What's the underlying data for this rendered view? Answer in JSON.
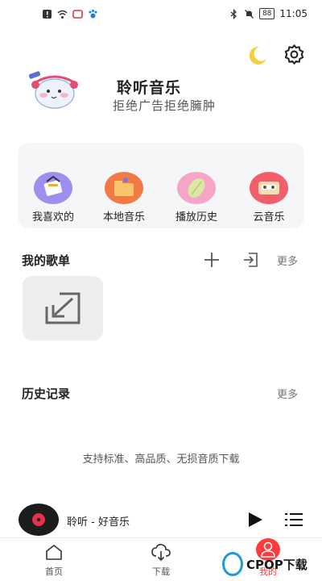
{
  "status_bar": {
    "time": "11:05",
    "battery": "88",
    "left_icons": [
      "notification-icon",
      "wifi-icon",
      "app-icon",
      "paw-icon"
    ],
    "right_icons": [
      "bluetooth-icon",
      "mute-icon",
      "battery-icon"
    ]
  },
  "header": {
    "title": "聆听音乐",
    "slogan": "拒绝广告拒绝臃肿",
    "night_mode_icon": "moon-icon",
    "settings_icon": "gear-icon"
  },
  "quick_actions": [
    {
      "label": "我喜欢的",
      "icon": "favorites-icon",
      "color": "#9f8df0"
    },
    {
      "label": "本地音乐",
      "icon": "local-music-icon",
      "color": "#f47a45"
    },
    {
      "label": "播放历史",
      "icon": "history-icon",
      "color": "#f5a6c7"
    },
    {
      "label": "云音乐",
      "icon": "cloud-music-icon",
      "color": "#f25e6a"
    }
  ],
  "playlists": {
    "title": "我的歌单",
    "more": "更多",
    "add_icon": "plus-icon",
    "import_icon": "import-icon",
    "tile_icon": "import-arrow-icon"
  },
  "history": {
    "title": "历史记录",
    "more": "更多",
    "empty_hint": "支持标准、高品质、无损音质下载"
  },
  "player": {
    "now_playing": "聆听 - 好音乐",
    "play_icon": "play-icon",
    "playlist_icon": "list-icon"
  },
  "bottom_nav": [
    {
      "label": "首页",
      "icon": "home-icon"
    },
    {
      "label": "下载",
      "icon": "download-icon"
    },
    {
      "label": "我的",
      "icon": "person-icon",
      "active": true
    }
  ],
  "colors": {
    "accent": "#ff3b3b",
    "card_bg": "#f5f6f8",
    "moon": "#f4d03f"
  },
  "watermark": {
    "text": "CPOP下载"
  }
}
